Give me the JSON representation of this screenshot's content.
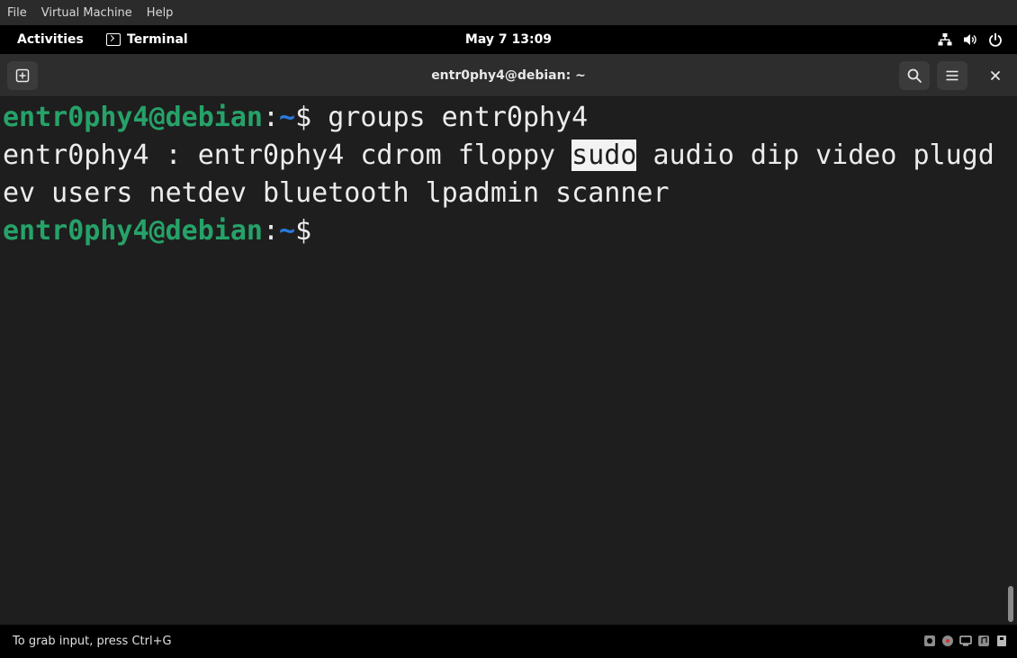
{
  "vm_menubar": {
    "items": [
      {
        "label": "File"
      },
      {
        "label": "Virtual Machine"
      },
      {
        "label": "Help"
      }
    ]
  },
  "gnome_topbar": {
    "activities_label": "Activities",
    "app_name": "Terminal",
    "clock": "May 7  13:09",
    "status_icons": [
      "network-icon",
      "volume-icon",
      "power-icon"
    ]
  },
  "terminal": {
    "title": "entr0phy4@debian: ~",
    "lines": [
      {
        "prompt_user": "entr0phy4@debian",
        "prompt_colon": ":",
        "prompt_path": "~",
        "prompt_symbol": "$",
        "command": " groups entr0phy4"
      },
      {
        "before_highlight": "entr0phy4 : entr0phy4 cdrom floppy ",
        "highlight": "sudo",
        "after_highlight": " audio dip video plugd"
      },
      {
        "text": "ev users netdev bluetooth lpadmin scanner"
      },
      {
        "prompt_user": "entr0phy4@debian",
        "prompt_colon": ":",
        "prompt_path": "~",
        "prompt_symbol": "$",
        "command": ""
      }
    ]
  },
  "vm_statusbar": {
    "hint": "To grab input, press Ctrl+G"
  },
  "colors": {
    "prompt_user": "#26a269",
    "prompt_path": "#2a7bde",
    "terminal_bg": "#1e1e1e",
    "highlight_bg": "#f2f2f2"
  }
}
